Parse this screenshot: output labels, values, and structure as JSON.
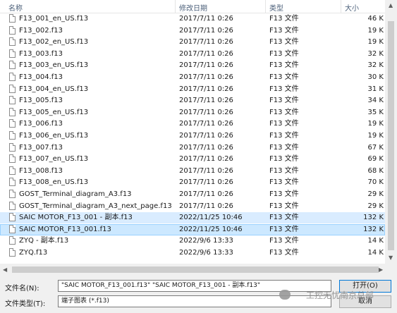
{
  "columns": {
    "name": "名称",
    "date": "修改日期",
    "type": "类型",
    "size": "大小"
  },
  "files": [
    {
      "name": "F13_001_en_US.f13",
      "date": "2017/7/11 0:26",
      "type": "F13 文件",
      "size": "46 K"
    },
    {
      "name": "F13_002.f13",
      "date": "2017/7/11 0:26",
      "type": "F13 文件",
      "size": "19 K"
    },
    {
      "name": "F13_002_en_US.f13",
      "date": "2017/7/11 0:26",
      "type": "F13 文件",
      "size": "19 K"
    },
    {
      "name": "F13_003.f13",
      "date": "2017/7/11 0:26",
      "type": "F13 文件",
      "size": "32 K"
    },
    {
      "name": "F13_003_en_US.f13",
      "date": "2017/7/11 0:26",
      "type": "F13 文件",
      "size": "32 K"
    },
    {
      "name": "F13_004.f13",
      "date": "2017/7/11 0:26",
      "type": "F13 文件",
      "size": "30 K"
    },
    {
      "name": "F13_004_en_US.f13",
      "date": "2017/7/11 0:26",
      "type": "F13 文件",
      "size": "31 K"
    },
    {
      "name": "F13_005.f13",
      "date": "2017/7/11 0:26",
      "type": "F13 文件",
      "size": "34 K"
    },
    {
      "name": "F13_005_en_US.f13",
      "date": "2017/7/11 0:26",
      "type": "F13 文件",
      "size": "35 K"
    },
    {
      "name": "F13_006.f13",
      "date": "2017/7/11 0:26",
      "type": "F13 文件",
      "size": "19 K"
    },
    {
      "name": "F13_006_en_US.f13",
      "date": "2017/7/11 0:26",
      "type": "F13 文件",
      "size": "19 K"
    },
    {
      "name": "F13_007.f13",
      "date": "2017/7/11 0:26",
      "type": "F13 文件",
      "size": "67 K"
    },
    {
      "name": "F13_007_en_US.f13",
      "date": "2017/7/11 0:26",
      "type": "F13 文件",
      "size": "69 K"
    },
    {
      "name": "F13_008.f13",
      "date": "2017/7/11 0:26",
      "type": "F13 文件",
      "size": "68 K"
    },
    {
      "name": "F13_008_en_US.f13",
      "date": "2017/7/11 0:26",
      "type": "F13 文件",
      "size": "70 K"
    },
    {
      "name": "GOST_Terminal_diagram_A3.f13",
      "date": "2017/7/11 0:26",
      "type": "F13 文件",
      "size": "29 K"
    },
    {
      "name": "GOST_Terminal_diagram_A3_next_page.f13",
      "date": "2017/7/11 0:26",
      "type": "F13 文件",
      "size": "29 K"
    },
    {
      "name": "SAIC MOTOR_F13_001 - 副本.f13",
      "date": "2022/11/25 10:46",
      "type": "F13 文件",
      "size": "132 K",
      "selected": true
    },
    {
      "name": "SAIC MOTOR_F13_001.f13",
      "date": "2022/11/25 10:46",
      "type": "F13 文件",
      "size": "132 K",
      "selected": true,
      "focused": true
    },
    {
      "name": "ZYQ - 副本.f13",
      "date": "2022/9/6 13:33",
      "type": "F13 文件",
      "size": "14 K"
    },
    {
      "name": "ZYQ.f13",
      "date": "2022/9/6 13:33",
      "type": "F13 文件",
      "size": "14 K"
    }
  ],
  "bottom": {
    "filename_label": "文件名(N):",
    "filename_value": "\"SAIC MOTOR_F13_001.f13\" \"SAIC MOTOR_F13_001 - 副本.f13\"",
    "filetype_label": "文件类型(T):",
    "filetype_value": "端子图表 (*.f13)",
    "open_button": "打开(O)",
    "cancel_button": "取消"
  },
  "watermark": "工控无忧南京总部",
  "colors": {
    "selection": "#cce8ff",
    "header_text": "#4c607a"
  }
}
